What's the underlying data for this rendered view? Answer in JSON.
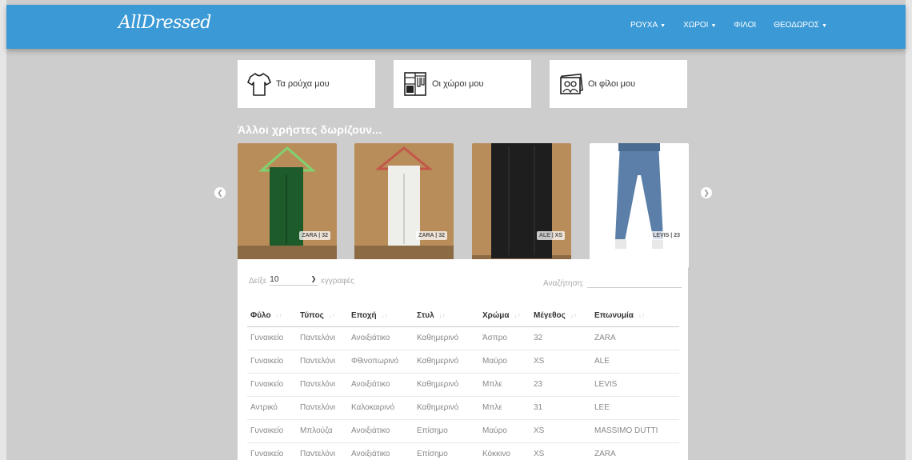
{
  "app": {
    "logo": "AllDressed"
  },
  "nav": {
    "items": [
      {
        "label": "ΡΟΥΧΑ",
        "has_dropdown": true
      },
      {
        "label": "ΧΩΡΟΙ",
        "has_dropdown": true
      },
      {
        "label": "ΦΙΛΟΙ",
        "has_dropdown": false
      },
      {
        "label": "ΘΕΟΔΩΡΟΣ",
        "has_dropdown": true
      }
    ]
  },
  "shortcuts": [
    {
      "label": "Τα ρούχα μου",
      "icon": "tshirt-icon"
    },
    {
      "label": "Οι χώροι μου",
      "icon": "wardrobe-icon"
    },
    {
      "label": "Οι φίλοι μου",
      "icon": "friends-photo-icon"
    }
  ],
  "carousel": {
    "title": "Άλλοι χρήστες δωρίζουν...",
    "items": [
      {
        "tag": "ZARA | 32",
        "garment_color": "#1d5b2a"
      },
      {
        "tag": "ZARA | 32",
        "garment_color": "#eeeeea"
      },
      {
        "tag": "ALE | XS",
        "garment_color": "#1e1e1e"
      },
      {
        "tag": "LEVIS | 23",
        "garment_color": "#5b7fa8"
      }
    ]
  },
  "table": {
    "length_label": "Δείξε",
    "length_value": "10",
    "length_suffix": "εγγραφές",
    "search_label": "Αναζήτηση:",
    "search_value": "",
    "columns": [
      "Φύλο",
      "Τύπος",
      "Εποχή",
      "Στυλ",
      "Χρώμα",
      "Μέγεθος",
      "Επωνυμία"
    ],
    "rows": [
      [
        "Γυναικείο",
        "Παντελόνι",
        "Ανοιξιάτικο",
        "Καθημερινό",
        "Άσπρο",
        "32",
        "ZARA"
      ],
      [
        "Γυναικείο",
        "Παντελόνι",
        "Φθινοπωρινό",
        "Καθημερινό",
        "Μαύρο",
        "XS",
        "ALE"
      ],
      [
        "Γυναικείο",
        "Παντελόνι",
        "Ανοιξιάτικο",
        "Καθημερινό",
        "Μπλε",
        "23",
        "LEVIS"
      ],
      [
        "Αντρικό",
        "Παντελόνι",
        "Καλοκαιρινό",
        "Καθημερινό",
        "Μπλε",
        "31",
        "LEE"
      ],
      [
        "Γυναικείο",
        "Μπλούζα",
        "Ανοιξιάτικο",
        "Επίσημο",
        "Μαύρο",
        "XS",
        "MASSIMO DUTTI"
      ],
      [
        "Γυναικείο",
        "Παντελόνι",
        "Ανοιξιάτικο",
        "Επίσημο",
        "Κόκκινο",
        "XS",
        "ZARA"
      ]
    ]
  },
  "colors": {
    "navbar": "#3b99d5",
    "background": "#cdcdcd",
    "wood": "#b98d5a"
  }
}
